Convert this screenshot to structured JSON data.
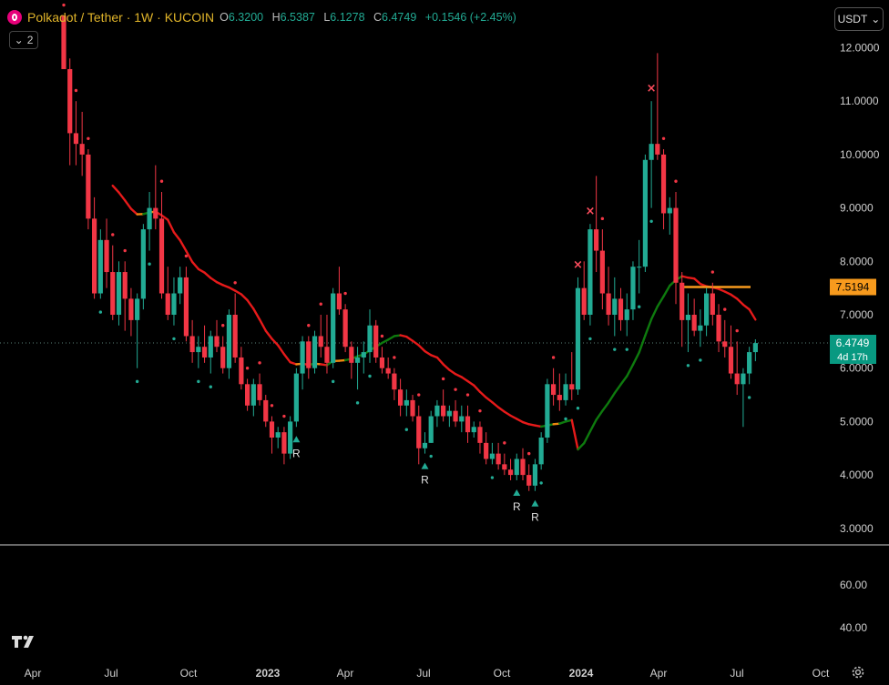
{
  "header": {
    "title": "Polkadot / Tether · 1W · KUCOIN",
    "o_label": "O",
    "o_value": "6.3200",
    "h_label": "H",
    "h_value": "6.5387",
    "l_label": "L",
    "l_value": "6.1278",
    "c_label": "C",
    "c_value": "6.4749",
    "change": "+0.1546 (+2.45%)",
    "indicator_count": "2",
    "currency": "USDT"
  },
  "colors": {
    "up": "#22ab94",
    "down": "#f23645",
    "ma_down": "#e61a1a",
    "ma_up": "#0e7a0e",
    "ma_flat": "#f0880f",
    "level": "#f79a1d",
    "bg": "#000000"
  },
  "chart_data": [
    {
      "type": "candlestick",
      "y_axis": {
        "labels": [
          "12.0000",
          "11.0000",
          "10.0000",
          "9.0000",
          "8.0000",
          "7.0000",
          "6.0000",
          "5.0000",
          "4.0000",
          "3.0000"
        ],
        "min": 2.5,
        "max": 12.6
      },
      "x_axis": {
        "labels": [
          "Apr",
          "Jul",
          "Oct",
          "2023",
          "Apr",
          "Jul",
          "Oct",
          "2024",
          "Apr",
          "Jul",
          "Oct"
        ]
      },
      "last_price": "6.4749",
      "countdown": "4d 17h",
      "level_price": "7.5194",
      "ohlc": [
        [
          12.6,
          12.6,
          11.6,
          11.6
        ],
        [
          11.6,
          11.8,
          9.8,
          10.4
        ],
        [
          10.4,
          11.0,
          9.8,
          10.2
        ],
        [
          10.2,
          10.8,
          9.6,
          10.0
        ],
        [
          10.0,
          10.1,
          8.6,
          8.8
        ],
        [
          8.8,
          9.2,
          7.3,
          7.4
        ],
        [
          7.4,
          8.6,
          7.3,
          8.4
        ],
        [
          8.4,
          8.8,
          7.5,
          7.8
        ],
        [
          7.8,
          8.3,
          6.9,
          7.0
        ],
        [
          7.0,
          8.0,
          6.8,
          7.8
        ],
        [
          7.8,
          8.0,
          6.7,
          7.3
        ],
        [
          7.3,
          7.5,
          6.6,
          6.9
        ],
        [
          6.9,
          7.4,
          6.0,
          7.3
        ],
        [
          7.3,
          8.7,
          7.1,
          8.6
        ],
        [
          8.6,
          9.3,
          8.2,
          9.0
        ],
        [
          9.0,
          9.8,
          8.6,
          8.8
        ],
        [
          8.8,
          9.3,
          7.3,
          7.4
        ],
        [
          7.4,
          7.9,
          6.9,
          7.0
        ],
        [
          7.0,
          7.7,
          6.8,
          7.4
        ],
        [
          7.4,
          7.9,
          7.2,
          7.7
        ],
        [
          7.7,
          7.9,
          6.5,
          6.6
        ],
        [
          6.6,
          6.9,
          6.1,
          6.3
        ],
        [
          6.3,
          6.6,
          6.0,
          6.4
        ],
        [
          6.4,
          6.8,
          6.1,
          6.2
        ],
        [
          6.2,
          6.7,
          5.9,
          6.6
        ],
        [
          6.6,
          6.9,
          6.3,
          6.4
        ],
        [
          6.4,
          6.6,
          5.9,
          6.0
        ],
        [
          6.0,
          7.1,
          5.8,
          7.0
        ],
        [
          7.0,
          7.4,
          6.1,
          6.2
        ],
        [
          6.2,
          6.4,
          5.6,
          5.7
        ],
        [
          5.7,
          5.8,
          5.2,
          5.3
        ],
        [
          5.3,
          5.8,
          5.1,
          5.7
        ],
        [
          5.7,
          5.9,
          5.3,
          5.4
        ],
        [
          5.4,
          5.5,
          4.9,
          5.0
        ],
        [
          5.0,
          5.1,
          4.4,
          4.7
        ],
        [
          4.7,
          4.9,
          4.5,
          4.8
        ],
        [
          4.8,
          4.9,
          4.2,
          4.4
        ],
        [
          4.4,
          5.1,
          4.3,
          5.0
        ],
        [
          5.0,
          6.0,
          4.9,
          5.9
        ],
        [
          5.9,
          6.6,
          5.6,
          6.5
        ],
        [
          6.5,
          6.6,
          5.8,
          6.0
        ],
        [
          6.0,
          6.7,
          5.9,
          6.6
        ],
        [
          6.6,
          7.0,
          6.2,
          6.4
        ],
        [
          6.4,
          7.0,
          5.9,
          6.1
        ],
        [
          6.1,
          7.5,
          6.0,
          7.4
        ],
        [
          7.4,
          7.9,
          7.0,
          7.1
        ],
        [
          7.1,
          7.2,
          6.3,
          6.4
        ],
        [
          6.4,
          6.5,
          5.8,
          6.1
        ],
        [
          6.1,
          6.4,
          5.6,
          6.2
        ],
        [
          6.2,
          6.5,
          5.9,
          6.3
        ],
        [
          6.3,
          7.1,
          6.1,
          6.8
        ],
        [
          6.8,
          6.9,
          6.1,
          6.2
        ],
        [
          6.2,
          6.4,
          5.9,
          6.0
        ],
        [
          6.0,
          6.2,
          5.8,
          5.9
        ],
        [
          5.9,
          6.0,
          5.4,
          5.6
        ],
        [
          5.6,
          5.8,
          5.1,
          5.3
        ],
        [
          5.3,
          5.6,
          5.1,
          5.4
        ],
        [
          5.4,
          5.5,
          5.0,
          5.1
        ],
        [
          5.1,
          5.3,
          4.2,
          4.5
        ],
        [
          4.5,
          4.8,
          4.4,
          4.6
        ],
        [
          4.6,
          5.2,
          4.6,
          5.1
        ],
        [
          5.1,
          5.4,
          4.9,
          5.3
        ],
        [
          5.3,
          5.6,
          5.0,
          5.1
        ],
        [
          5.1,
          5.3,
          4.9,
          5.2
        ],
        [
          5.2,
          5.4,
          4.9,
          5.0
        ],
        [
          5.0,
          5.3,
          4.8,
          5.1
        ],
        [
          5.1,
          5.3,
          4.6,
          4.8
        ],
        [
          4.8,
          5.0,
          4.7,
          4.9
        ],
        [
          4.9,
          5.0,
          4.4,
          4.6
        ],
        [
          4.6,
          4.8,
          4.2,
          4.3
        ],
        [
          4.3,
          4.6,
          4.2,
          4.4
        ],
        [
          4.4,
          4.6,
          4.1,
          4.2
        ],
        [
          4.2,
          4.4,
          4.0,
          4.1
        ],
        [
          4.1,
          4.3,
          3.9,
          4.0
        ],
        [
          4.0,
          4.4,
          3.9,
          4.3
        ],
        [
          4.3,
          4.5,
          3.9,
          4.0
        ],
        [
          4.0,
          4.2,
          3.7,
          3.8
        ],
        [
          3.8,
          4.3,
          3.7,
          4.2
        ],
        [
          4.2,
          4.8,
          4.1,
          4.7
        ],
        [
          4.7,
          5.8,
          4.6,
          5.7
        ],
        [
          5.7,
          6.0,
          5.3,
          5.5
        ],
        [
          5.5,
          5.9,
          5.2,
          5.4
        ],
        [
          5.4,
          5.9,
          5.3,
          5.7
        ],
        [
          5.7,
          6.3,
          5.4,
          5.6
        ],
        [
          5.6,
          7.7,
          5.5,
          7.5
        ],
        [
          7.5,
          8.0,
          6.9,
          7.0
        ],
        [
          7.0,
          8.7,
          6.8,
          8.6
        ],
        [
          8.6,
          9.6,
          7.8,
          8.2
        ],
        [
          8.2,
          8.6,
          7.1,
          7.4
        ],
        [
          7.4,
          7.9,
          6.8,
          7.0
        ],
        [
          7.0,
          7.7,
          6.6,
          7.3
        ],
        [
          7.3,
          7.5,
          6.7,
          6.9
        ],
        [
          6.9,
          7.4,
          6.6,
          7.1
        ],
        [
          7.1,
          8.0,
          6.9,
          7.9
        ],
        [
          7.9,
          8.4,
          7.4,
          7.9
        ],
        [
          7.9,
          10.0,
          7.8,
          9.9
        ],
        [
          9.9,
          11.0,
          9.0,
          10.2
        ],
        [
          10.2,
          11.9,
          9.9,
          10.0
        ],
        [
          10.0,
          10.1,
          8.6,
          8.9
        ],
        [
          8.9,
          9.2,
          8.5,
          9.0
        ],
        [
          9.0,
          9.3,
          7.2,
          7.6
        ],
        [
          7.6,
          7.8,
          6.4,
          6.9
        ],
        [
          6.9,
          7.4,
          6.3,
          7.0
        ],
        [
          7.0,
          7.3,
          6.6,
          6.7
        ],
        [
          6.7,
          7.1,
          6.4,
          6.8
        ],
        [
          6.8,
          7.5,
          6.6,
          7.4
        ],
        [
          7.4,
          7.6,
          6.8,
          7.0
        ],
        [
          7.0,
          7.2,
          6.3,
          6.5
        ],
        [
          6.5,
          6.9,
          6.2,
          6.4
        ],
        [
          6.4,
          6.8,
          5.8,
          5.9
        ],
        [
          5.9,
          6.5,
          5.5,
          5.7
        ],
        [
          5.7,
          6.0,
          4.9,
          5.9
        ],
        [
          5.9,
          6.4,
          5.7,
          6.3
        ],
        [
          6.3,
          6.54,
          6.13,
          6.47
        ]
      ],
      "signals": [
        {
          "label": "R",
          "bar": 38,
          "dir": "buy"
        },
        {
          "label": "R",
          "bar": 59,
          "dir": "buy"
        },
        {
          "label": "R",
          "bar": 74,
          "dir": "buy"
        },
        {
          "label": "R",
          "bar": 77,
          "dir": "buy"
        },
        {
          "label": "",
          "bar": 84,
          "dir": "sell"
        },
        {
          "label": "",
          "bar": 86,
          "dir": "sell"
        },
        {
          "label": "",
          "bar": 96,
          "dir": "sell"
        }
      ]
    },
    {
      "type": "line",
      "y_axis": {
        "labels": [
          "60.00",
          "40.00"
        ]
      }
    }
  ]
}
